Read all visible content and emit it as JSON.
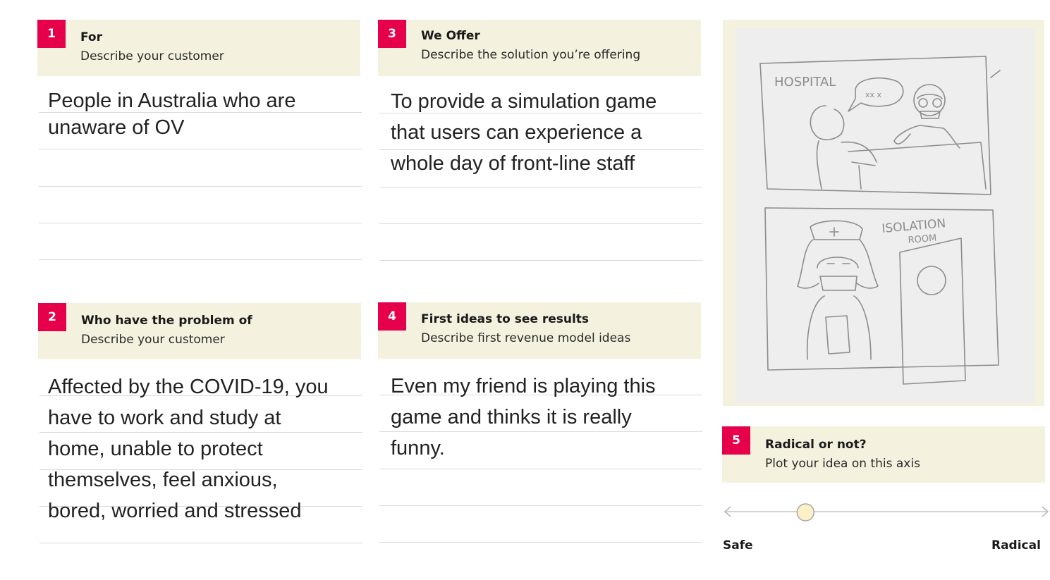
{
  "cards": [
    {
      "number": "1",
      "title": "For",
      "subtitle": "Describe your customer",
      "text": "People in Australia who are\nunaware of OV"
    },
    {
      "number": "2",
      "title": "Who have the problem of",
      "subtitle": "Describe your customer",
      "text": "Affected by the COVID-19, you\nhave to work and study at\nhome, unable to protect\nthemselves, feel anxious,\nbored, worried and stressed"
    },
    {
      "number": "3",
      "title": "We Offer",
      "subtitle": "Describe the solution you’re offering",
      "text": "To provide a simulation game\nthat users can experience a\nwhole day of front-line staff"
    },
    {
      "number": "4",
      "title": "First ideas to see results",
      "subtitle": "Describe first revenue model ideas",
      "text": "Even my friend is playing this\ngame and thinks it is really\nfunny."
    }
  ],
  "sketch": {
    "panel_top_label": "HOSPITAL",
    "speech_text": "xx x",
    "panel_bottom_label_1": "ISOLATION",
    "panel_bottom_label_2": "ROOM"
  },
  "radical": {
    "number": "5",
    "title": "Radical or not?",
    "subtitle": "Plot your idea on this axis",
    "safe_label": "Safe",
    "radical_label": "Radical",
    "value_fraction": 0.25
  },
  "colors": {
    "badge": "#e6004c",
    "header_bg": "#f4f2df",
    "rule": "#dadada",
    "slider_knob": "#fdf0c8"
  }
}
